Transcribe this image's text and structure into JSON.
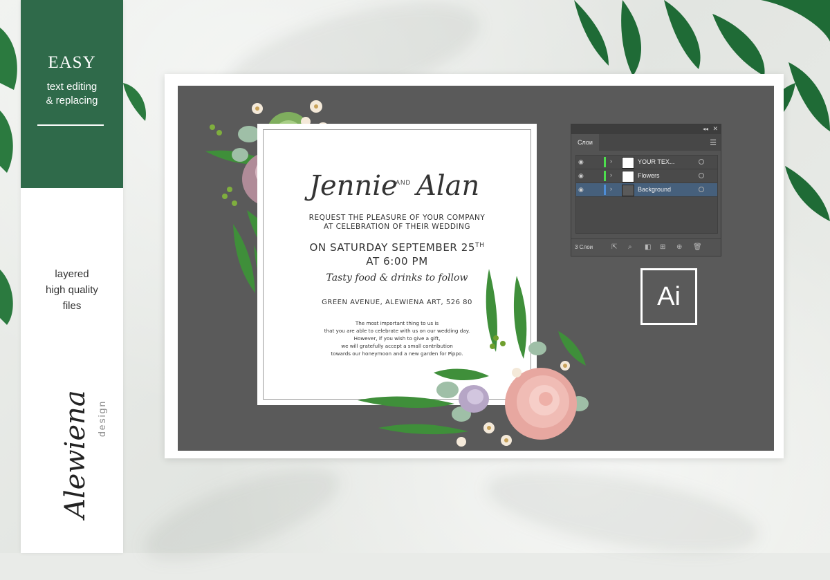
{
  "sidebar": {
    "headline": "EASY",
    "subline_1": "text editing",
    "subline_2": "& replacing",
    "feature_1": "layered",
    "feature_2": "high quality",
    "feature_3": "files",
    "brand_name": "Alewiena",
    "brand_sub": "design",
    "accent_color": "#2f6a4a"
  },
  "invitation": {
    "name_1": "Jennie",
    "and": "AND",
    "name_2": "Alan",
    "request_1": "REQUEST THE PLEASURE OF YOUR COMPANY",
    "request_2": "AT CELEBRATION OF THEIR WEDDING",
    "date_1": "ON SATURDAY SEPTEMBER 25",
    "date_sup": "TH",
    "date_2": "AT 6:00 PM",
    "tasty": "Tasty food & drinks to follow",
    "address": "GREEN AVENUE, ALEWIENA ART,  526 80",
    "small_1": "The most important thing to us is",
    "small_2": "that you are able to celebrate with us on our wedding day.",
    "small_3": "However, if you wish to give a gift,",
    "small_4": "we will gratefully accept a small contribution",
    "small_5": "towards our honeymoon and a new garden for Pippo."
  },
  "layers_panel": {
    "tab": "Слои",
    "layers": [
      {
        "name": "YOUR TEX...",
        "selected": false
      },
      {
        "name": "Flowers",
        "selected": false
      },
      {
        "name": "Background",
        "selected": true
      }
    ],
    "count": "3 Слои"
  },
  "app_logo": "Ai"
}
